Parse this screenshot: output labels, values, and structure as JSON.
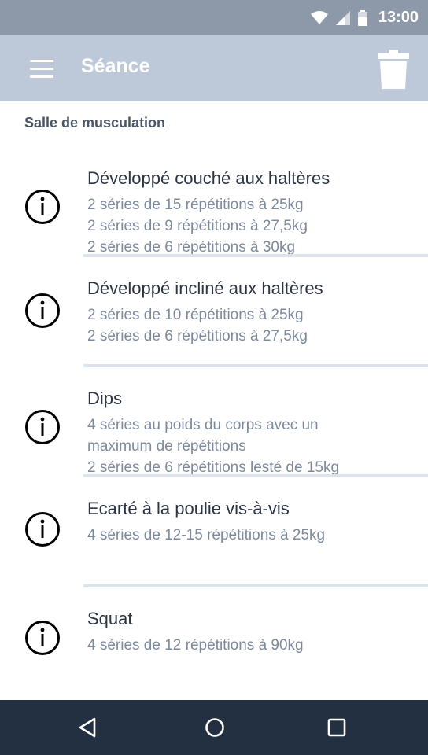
{
  "status_bar": {
    "time": "13:00",
    "icons": [
      "wifi-icon",
      "signal-icon",
      "battery-icon"
    ]
  },
  "app_bar": {
    "title": "Séance",
    "menu_icon": "menu-icon",
    "action_icon": "trash-icon"
  },
  "section": {
    "title": "Salle de musculation"
  },
  "exercises": [
    {
      "name": "Développé couché aux haltères",
      "sets": [
        "2 séries de 15 répétitions à 25kg",
        "2 séries de 9 répétitions à 27,5kg",
        "2 séries de 6 répétitions à 30kg"
      ]
    },
    {
      "name": "Développé incliné aux haltères",
      "sets": [
        "2 séries de 10 répétitions à 25kg",
        "2 séries de 6 répétitions à 27,5kg"
      ]
    },
    {
      "name": "Dips",
      "sets": [
        "4 séries au poids du corps avec un",
        "maximum de répétitions",
        "2 séries de 6 répétitions lesté de 15kg"
      ]
    },
    {
      "name": "Ecarté à la poulie vis-à-vis",
      "sets": [
        "4 séries de 12-15 répétitions à 25kg"
      ]
    },
    {
      "name": "Squat",
      "sets": [
        "4 séries de 12 répétitions à 90kg"
      ]
    }
  ],
  "nav_bar": {
    "icons": [
      "back-icon",
      "home-icon",
      "recents-icon"
    ]
  },
  "colors": {
    "status_bar": "#8d98a8",
    "app_bar": "#bdc9d8",
    "nav_bar": "#233041",
    "title_text": "#2b3442",
    "detail_text": "#7d8a9c"
  }
}
